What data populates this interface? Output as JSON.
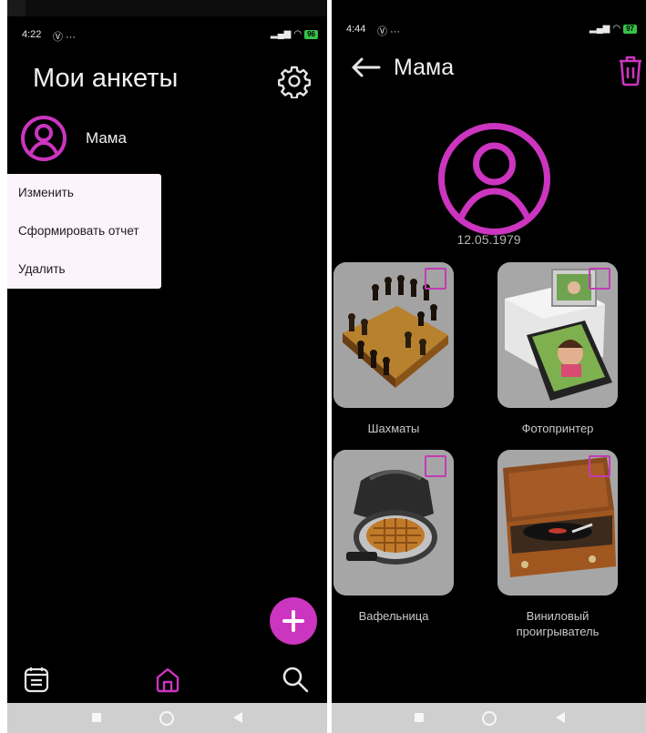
{
  "colors": {
    "accent": "#cc35bf",
    "background": "#000000",
    "menu_bg": "#fdf3fb",
    "card_bg": "#9e9e9e",
    "sysbar": "#cfcfcf"
  },
  "left_screen": {
    "status": {
      "time": "4:22",
      "extra": "Ⓥ ···",
      "battery": "96"
    },
    "title": "Мои анкеты",
    "settings_icon": "gear-icon",
    "profile": {
      "name": "Мама",
      "icon": "person-circle-icon"
    },
    "context_menu": [
      {
        "label": "Изменить"
      },
      {
        "label": "Сформировать отчет"
      },
      {
        "label": "Удалить"
      }
    ],
    "fab_icon": "plus-icon",
    "bottom_nav": [
      {
        "icon": "list-icon",
        "active": false
      },
      {
        "icon": "home-icon",
        "active": true
      },
      {
        "icon": "search-icon",
        "active": false
      }
    ]
  },
  "right_screen": {
    "status": {
      "time": "4:44",
      "extra": "Ⓥ ···",
      "battery": "97"
    },
    "title": "Мама",
    "back_icon": "arrow-left-icon",
    "delete_icon": "trash-icon",
    "avatar_icon": "person-circle-icon",
    "birth_date": "12.05.1979",
    "items": [
      {
        "label": "Шахматы",
        "image": "chess-board",
        "checked": false
      },
      {
        "label": "Фотопринтер",
        "image": "photo-printer",
        "checked": false
      },
      {
        "label": "Вафельница",
        "image": "waffle-maker",
        "checked": false
      },
      {
        "label": "Виниловый\nпроигрыватель",
        "image": "vinyl-player",
        "checked": false
      }
    ]
  },
  "system_nav": [
    "square-button",
    "circle-button",
    "back-triangle-button"
  ]
}
